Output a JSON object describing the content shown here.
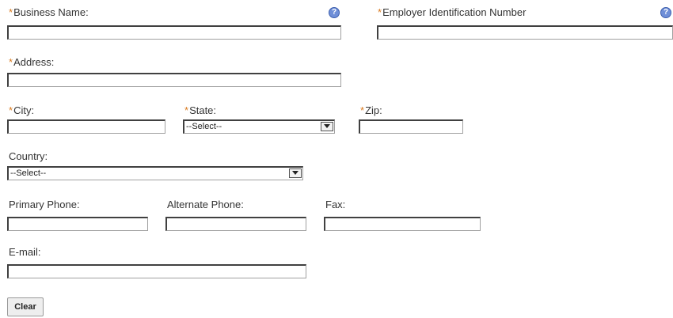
{
  "required_marker": "*",
  "help_glyph": "?",
  "fields": {
    "business_name": {
      "label": "Business Name:",
      "value": ""
    },
    "ein": {
      "label": "Employer Identification Number",
      "value": ""
    },
    "address": {
      "label": "Address:",
      "value": ""
    },
    "city": {
      "label": "City:",
      "value": ""
    },
    "state": {
      "label": "State:",
      "selected": "--Select--"
    },
    "zip": {
      "label": "Zip:",
      "value": ""
    },
    "country": {
      "label": "Country:",
      "selected": "--Select--"
    },
    "primary_phone": {
      "label": "Primary Phone:",
      "value": ""
    },
    "alternate_phone": {
      "label": "Alternate Phone:",
      "value": ""
    },
    "fax": {
      "label": "Fax:",
      "value": ""
    },
    "email": {
      "label": "E-mail:",
      "value": ""
    }
  },
  "buttons": {
    "clear": "Clear"
  },
  "colors": {
    "required": "#d97a1f",
    "help_icon": "#6f8fd8",
    "text": "#333333"
  }
}
